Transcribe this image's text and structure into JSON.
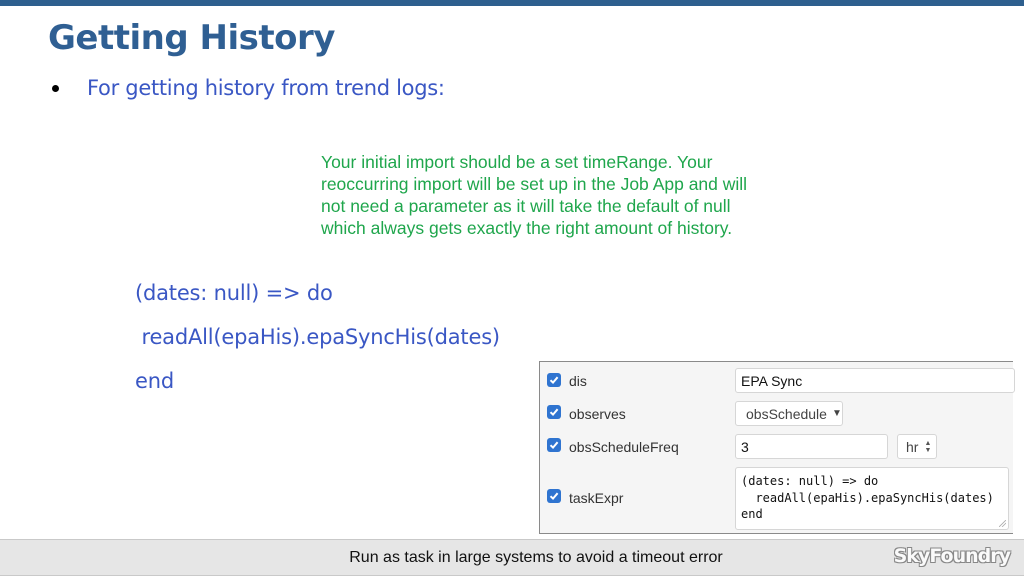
{
  "slide": {
    "title": "Getting History",
    "bullet": "For getting history from trend logs:",
    "note_lines": [
      "Your initial import should be a set timeRange.  Your",
      "reoccurring import will be set up in the Job App and will",
      "not need a parameter as it will take the default of null",
      "which always gets exactly the right amount of history."
    ],
    "code_lines": [
      "(dates: null) => do",
      " readAll(epaHis).epaSyncHis(dates)",
      "end"
    ]
  },
  "form": {
    "fields": [
      {
        "label": "dis",
        "checked": true,
        "value": "EPA Sync"
      },
      {
        "label": "observes",
        "checked": true,
        "value": "obsSchedule",
        "icon": "caret-down-icon"
      },
      {
        "label": "obsScheduleFreq",
        "checked": true,
        "value": "3",
        "unit": "hr",
        "unit_icon": "stepper-icon"
      },
      {
        "label": "taskExpr",
        "checked": true,
        "value_lines": [
          "(dates: null) => do",
          "  readAll(epaHis).epaSyncHis(dates)",
          "end"
        ]
      }
    ]
  },
  "footer": {
    "text": "Run as task in large systems to avoid a timeout error",
    "logo": "SkyFoundry"
  },
  "colors": {
    "title": "#2f5f93",
    "bullet_text": "#3a57c4",
    "note_text": "#1fa64c",
    "top_bar": "#2e5f8e",
    "checkbox": "#2f74d0"
  }
}
